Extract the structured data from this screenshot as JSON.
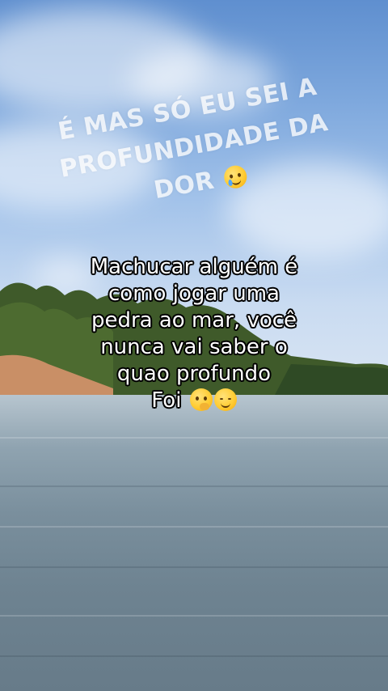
{
  "overlay": {
    "line1": "É MAS SÓ EU SEI A",
    "line2": "PROFUNDIDADE DA",
    "line3": "DOR",
    "emoji": "crying-face"
  },
  "caption": {
    "lines": [
      "Machucar alguém é",
      "como jogar uma",
      "pedra ao mar, você",
      "nunca vai saber o",
      "quao profundo",
      "Foi"
    ],
    "emojis": [
      "thinking-face",
      "relieved-face"
    ]
  }
}
